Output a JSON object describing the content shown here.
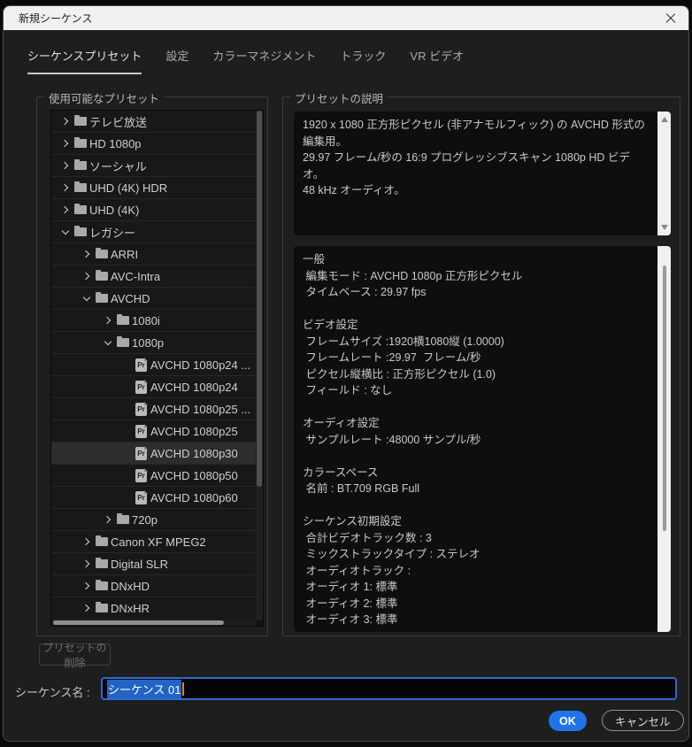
{
  "window": {
    "title": "新規シーケンス"
  },
  "tabs": {
    "items": [
      {
        "label": "シーケンスプリセット",
        "active": true
      },
      {
        "label": "設定",
        "active": false
      },
      {
        "label": "カラーマネジメント",
        "active": false
      },
      {
        "label": "トラック",
        "active": false
      },
      {
        "label": "VR ビデオ",
        "active": false
      }
    ]
  },
  "preset_tree": {
    "group_label": "使用可能なプリセット",
    "items": [
      {
        "label": "テレビ放送",
        "level": 0,
        "state": "collapsed",
        "kind": "folder"
      },
      {
        "label": "HD 1080p",
        "level": 0,
        "state": "collapsed",
        "kind": "folder"
      },
      {
        "label": "ソーシャル",
        "level": 0,
        "state": "collapsed",
        "kind": "folder"
      },
      {
        "label": "UHD (4K) HDR",
        "level": 0,
        "state": "collapsed",
        "kind": "folder"
      },
      {
        "label": "UHD (4K)",
        "level": 0,
        "state": "collapsed",
        "kind": "folder"
      },
      {
        "label": "レガシー",
        "level": 0,
        "state": "expanded",
        "kind": "folder"
      },
      {
        "label": "ARRI",
        "level": 1,
        "state": "collapsed",
        "kind": "folder"
      },
      {
        "label": "AVC-Intra",
        "level": 1,
        "state": "collapsed",
        "kind": "folder"
      },
      {
        "label": "AVCHD",
        "level": 1,
        "state": "expanded",
        "kind": "folder"
      },
      {
        "label": "1080i",
        "level": 2,
        "state": "collapsed",
        "kind": "folder"
      },
      {
        "label": "1080p",
        "level": 2,
        "state": "expanded",
        "kind": "folder"
      },
      {
        "label": "AVCHD 1080p24 ...",
        "level": 3,
        "kind": "preset"
      },
      {
        "label": "AVCHD 1080p24",
        "level": 3,
        "kind": "preset"
      },
      {
        "label": "AVCHD 1080p25 ...",
        "level": 3,
        "kind": "preset"
      },
      {
        "label": "AVCHD 1080p25",
        "level": 3,
        "kind": "preset"
      },
      {
        "label": "AVCHD 1080p30",
        "level": 3,
        "kind": "preset",
        "selected": true
      },
      {
        "label": "AVCHD 1080p50",
        "level": 3,
        "kind": "preset"
      },
      {
        "label": "AVCHD 1080p60",
        "level": 3,
        "kind": "preset"
      },
      {
        "label": "720p",
        "level": 2,
        "state": "collapsed",
        "kind": "folder"
      },
      {
        "label": "Canon XF MPEG2",
        "level": 1,
        "state": "collapsed",
        "kind": "folder"
      },
      {
        "label": "Digital SLR",
        "level": 1,
        "state": "collapsed",
        "kind": "folder"
      },
      {
        "label": "DNxHD",
        "level": 1,
        "state": "collapsed",
        "kind": "folder"
      },
      {
        "label": "DNxHR",
        "level": 1,
        "state": "collapsed",
        "kind": "folder"
      }
    ]
  },
  "description": {
    "group_label": "プリセットの説明",
    "summary_paragraphs": [
      "1920 x 1080 正方形ピクセル (非アナモルフィック) の AVCHD 形式の編集用。",
      "29.97 フレーム/秒の 16:9 プログレッシブスキャン 1080p HD ビデオ。",
      "48 kHz オーディオ。"
    ],
    "details_lines": [
      "一般",
      " 編集モード : AVCHD 1080p 正方形ピクセル",
      " タイムベース : 29.97 fps",
      "",
      "ビデオ設定",
      " フレームサイズ :1920横1080縦 (1.0000)",
      " フレームレート :29.97  フレーム/秒",
      " ピクセル縦横比 : 正方形ピクセル (1.0)",
      " フィールド : なし",
      "",
      "オーディオ設定",
      " サンプルレート :48000 サンプル/秒",
      "",
      "カラースペース",
      " 名前 : BT.709 RGB Full",
      "",
      "シーケンス初期設定",
      " 合計ビデオトラック数 : 3",
      " ミックストラックタイプ : ステレオ",
      " オーディオトラック :",
      " オーディオ 1: 標準",
      " オーディオ 2: 標準",
      " オーディオ 3: 標準"
    ]
  },
  "footer": {
    "delete_button_label": "プリセットの削除",
    "sequence_name_label": "シーケンス名 :",
    "sequence_name_value": "シーケンス 01",
    "ok_label": "OK",
    "cancel_label": "キャンセル"
  },
  "colors": {
    "accent_blue": "#2173e8",
    "selection_blue": "#2264c4",
    "focus_border_blue": "#2e6ad1",
    "titlebar_bg": "#f1f1f1",
    "dialog_bg": "#1e1e1e"
  }
}
